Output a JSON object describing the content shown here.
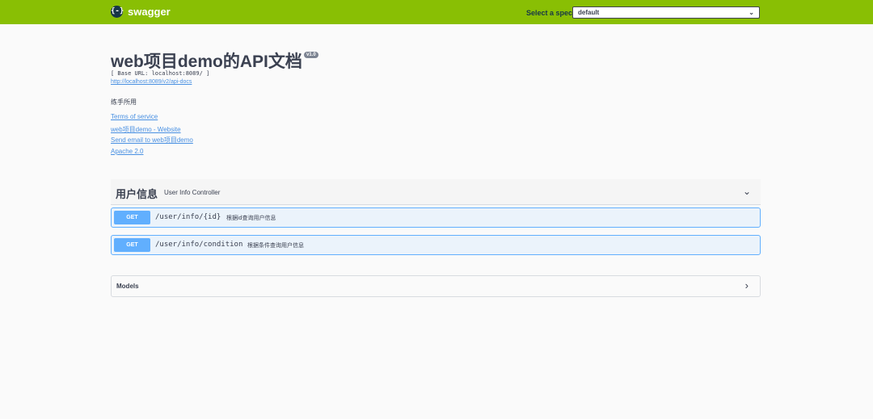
{
  "topbar": {
    "logo_glyph": "{-}",
    "logo_text": "swagger",
    "spec_label": "Select a spec",
    "spec_selected": "default",
    "color": "#89bf04"
  },
  "info": {
    "title": "web项目demo的API文档",
    "version": "v1.0",
    "base_url": "[ Base URL: localhost:8089/ ]",
    "docs_link": "http://localhost:8089/v2/api-docs",
    "description": "练手所用",
    "terms": "Terms of service",
    "website": "web项目demo - Website",
    "email": "Send email to web项目demo",
    "license": "Apache 2.0"
  },
  "tag": {
    "name": "用户信息",
    "description": "User Info Controller"
  },
  "operations": [
    {
      "method": "GET",
      "path": "/user/info/{id}",
      "summary": "根据id查询用户信息"
    },
    {
      "method": "GET",
      "path": "/user/info/condition",
      "summary": "根据条件查询用户信息"
    }
  ],
  "models": {
    "title": "Models"
  },
  "icons": {
    "chevron_down": "chevron-down-icon",
    "chevron_right": "chevron-right-icon",
    "logo": "swagger-logo-icon"
  },
  "colors": {
    "get": "#61affe",
    "get_bg": "#ebf3fb",
    "link": "#4990e2"
  }
}
